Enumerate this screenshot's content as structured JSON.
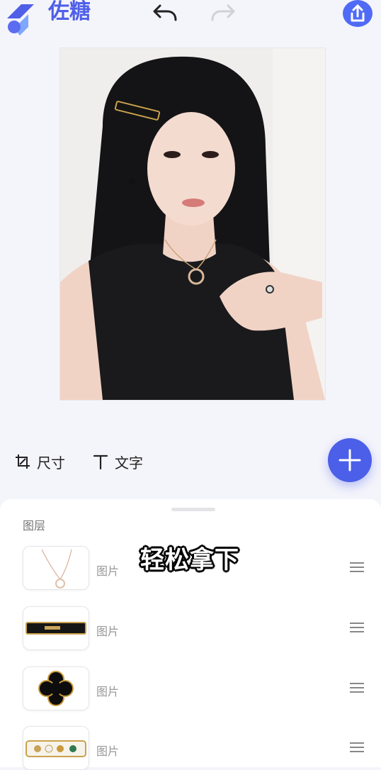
{
  "header": {
    "app_name": "佐糖",
    "logo_icon": "sugar-logo-icon",
    "undo_icon": "undo-icon",
    "redo_icon": "redo-icon",
    "share_icon": "share-icon"
  },
  "canvas": {
    "image_desc_icon": "portrait-photo"
  },
  "tools": {
    "size_label": "尺寸",
    "text_label": "文字",
    "add_icon": "plus-icon"
  },
  "layers": {
    "title": "图层",
    "overlay_caption": "轻松拿下",
    "items": [
      {
        "label": "图片",
        "thumb_icon": "necklace-icon"
      },
      {
        "label": "图片",
        "thumb_icon": "hair-clip-icon"
      },
      {
        "label": "图片",
        "thumb_icon": "clover-earring-icon"
      },
      {
        "label": "图片",
        "thumb_icon": "bracelet-icon"
      }
    ]
  },
  "colors": {
    "accent": "#4f5fe8",
    "background": "#f4f4fb"
  }
}
